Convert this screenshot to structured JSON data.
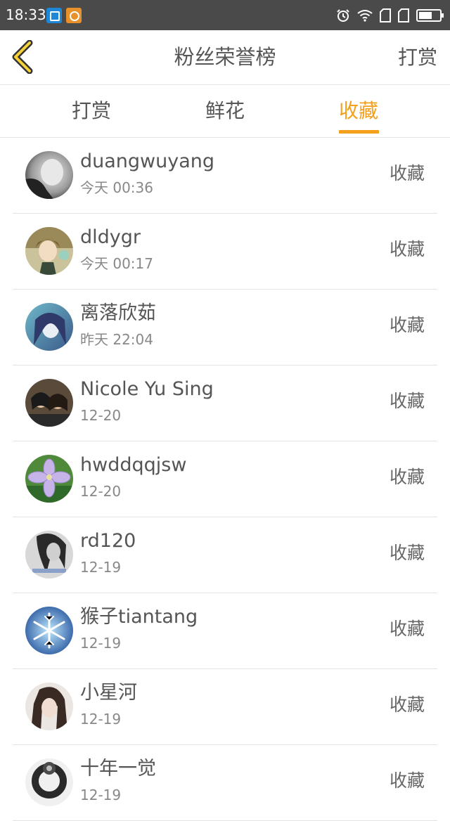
{
  "status_bar": {
    "time": "18:33"
  },
  "header": {
    "title": "粉丝荣誉榜",
    "action": "打赏"
  },
  "tabs": [
    {
      "label": "打赏",
      "active": false
    },
    {
      "label": "鲜花",
      "active": false
    },
    {
      "label": "收藏",
      "active": true
    }
  ],
  "colors": {
    "accent": "#f3a01c",
    "status_bar": "#4a4a4a",
    "text": "#555555"
  },
  "items": [
    {
      "name": "duangwuyang",
      "time": "今天 00:36",
      "action": "收藏",
      "avatar": "grayscale-portrait"
    },
    {
      "name": "dldygr",
      "time": "今天 00:17",
      "action": "收藏",
      "avatar": "anime-character"
    },
    {
      "name": "离落欣茹",
      "time": "昨天 22:04",
      "action": "收藏",
      "avatar": "blue-anime-girl"
    },
    {
      "name": "Nicole Yu Sing",
      "time": "12-20",
      "action": "收藏",
      "avatar": "two-girls-selfie"
    },
    {
      "name": "hwddqqjsw",
      "time": "12-20",
      "action": "收藏",
      "avatar": "purple-flower"
    },
    {
      "name": "rd120",
      "time": "12-19",
      "action": "收藏",
      "avatar": "gray-portrait"
    },
    {
      "name": "猴子tiantang",
      "time": "12-19",
      "action": "收藏",
      "avatar": "blue-snowflake"
    },
    {
      "name": "小星河",
      "time": "12-19",
      "action": "收藏",
      "avatar": "girl-portrait"
    },
    {
      "name": "十年一觉",
      "time": "12-19",
      "action": "收藏",
      "avatar": "dark-ring"
    }
  ]
}
